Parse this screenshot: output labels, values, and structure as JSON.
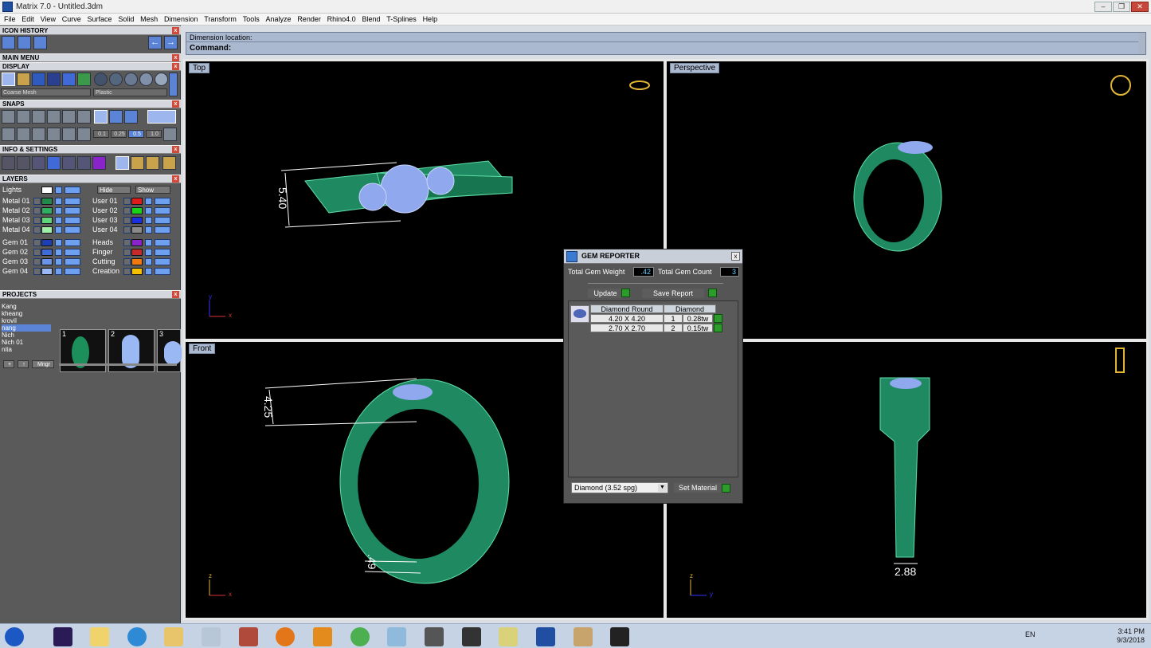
{
  "window": {
    "title": "Matrix 7.0 - Untitled.3dm",
    "minimize": "–",
    "restore": "❐",
    "close": "✕"
  },
  "menu": [
    "File",
    "Edit",
    "View",
    "Curve",
    "Surface",
    "Solid",
    "Mesh",
    "Dimension",
    "Transform",
    "Tools",
    "Analyze",
    "Render",
    "Rhino4.0",
    "Blend",
    "T-Splines",
    "Help"
  ],
  "panels": {
    "icon_history": "ICON HISTORY",
    "main_menu": "MAIN MENU",
    "display": "DISPLAY",
    "display_mesh": "Coarse Mesh",
    "display_material": "Plastic",
    "snaps": "SNAPS",
    "snap_values": [
      "0.1",
      "0.25",
      "0.5",
      "1.0"
    ],
    "info_settings": "INFO & SETTINGS",
    "layers": "LAYERS",
    "projects": "PROJECTS",
    "close_glyph": "x"
  },
  "layers": {
    "lights": "Lights",
    "hide": "Hide",
    "show": "Show",
    "left": [
      {
        "name": "Metal 01",
        "color": "#1f8a4c"
      },
      {
        "name": "Metal 02",
        "color": "#2fae62"
      },
      {
        "name": "Metal 03",
        "color": "#5fd57a"
      },
      {
        "name": "Metal 04",
        "color": "#9ff0a6"
      },
      {
        "name": "Gem 01",
        "color": "#1d3fb5"
      },
      {
        "name": "Gem 02",
        "color": "#3f6ad8"
      },
      {
        "name": "Gem 03",
        "color": "#6b93ea"
      },
      {
        "name": "Gem 04",
        "color": "#9ab9f4"
      }
    ],
    "right": [
      {
        "name": "User 01",
        "color": "#e01b1b"
      },
      {
        "name": "User 02",
        "color": "#1bd21b"
      },
      {
        "name": "User 03",
        "color": "#1b2fe0"
      },
      {
        "name": "User 04",
        "color": "#8a8a8a"
      },
      {
        "name": "Heads",
        "color": "#8a23c9"
      },
      {
        "name": "Finger",
        "color": "#c42a2a"
      },
      {
        "name": "Cutting",
        "color": "#f07a10"
      },
      {
        "name": "Creation",
        "color": "#f5c000"
      }
    ]
  },
  "projects": {
    "list": [
      "Kang",
      "kheang",
      "kroviI",
      "nang",
      "Nich",
      "Nich 01",
      "nita"
    ],
    "selected": 3,
    "thumbs": [
      "1",
      "2",
      "3"
    ],
    "mngr": "Mngr"
  },
  "command": {
    "line1": "Dimension location:",
    "line2": "Command:"
  },
  "viewports": {
    "top": {
      "label": "Top",
      "dim": "5.40"
    },
    "perspective": {
      "label": "Perspective"
    },
    "front": {
      "label": "Front",
      "dim1": "4.25",
      "dim2": ".49"
    },
    "right": {
      "label": "",
      "dim": "2.88"
    },
    "axes": {
      "x": "x",
      "y": "y",
      "z": "z"
    }
  },
  "gem_reporter": {
    "title": "GEM REPORTER",
    "total_weight_label": "Total Gem Weight",
    "total_weight": ".42",
    "total_count_label": "Total Gem Count",
    "total_count": "3",
    "update": "Update",
    "save_report": "Save Report",
    "table_headers": [
      "Diamond Round",
      "Diamond"
    ],
    "rows": [
      {
        "size": "4.20 X 4.20",
        "count": "1",
        "tw": "0.28tw"
      },
      {
        "size": "2.70 X 2.70",
        "count": "2",
        "tw": "0.15tw"
      }
    ],
    "material": "Diamond     (3.52 spg)",
    "set_material": "Set Material"
  },
  "taskbar": {
    "lang": "EN",
    "time": "3:41 PM",
    "date": "9/3/2018"
  }
}
